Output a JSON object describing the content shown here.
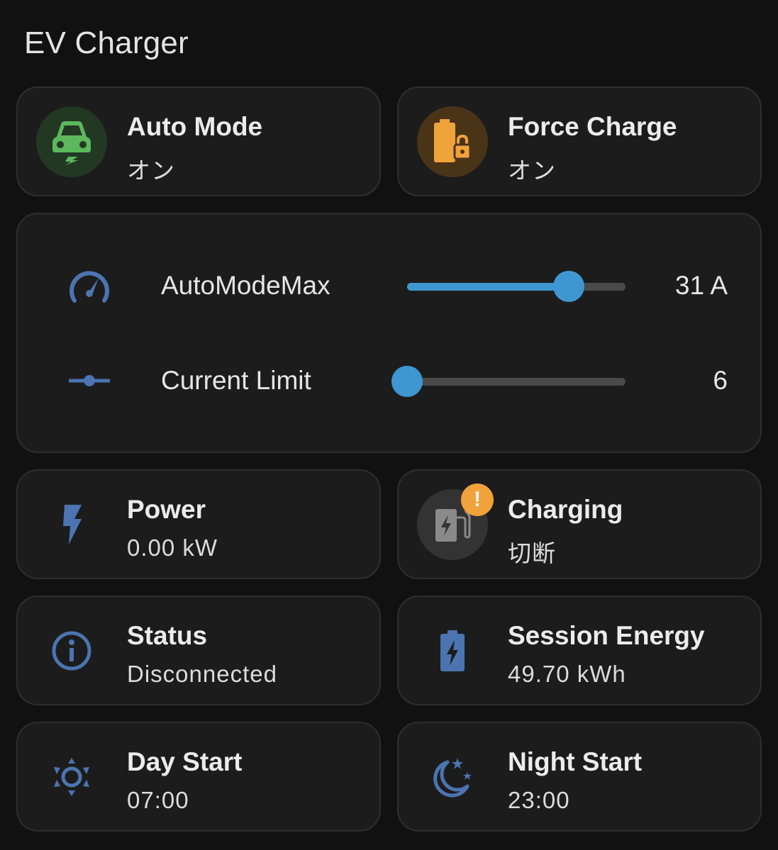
{
  "title": "EV Charger",
  "colors": {
    "accent": "#3e97d1",
    "icon_blue": "#4b74b0",
    "auto_mode_green": "#5cb85c",
    "force_charge_orange": "#f0a23b"
  },
  "tiles": {
    "auto_mode": {
      "name": "Auto Mode",
      "state": "オン",
      "icon": "car-electric-icon"
    },
    "force_charge": {
      "name": "Force Charge",
      "state": "オン",
      "icon": "battery-lock-icon"
    },
    "power": {
      "name": "Power",
      "state": "0.00 kW",
      "icon": "flash-icon"
    },
    "charging": {
      "name": "Charging",
      "state": "切断",
      "icon": "ev-station-icon",
      "badge": "!"
    },
    "status": {
      "name": "Status",
      "state": "Disconnected",
      "icon": "information-icon"
    },
    "session_energy": {
      "name": "Session Energy",
      "state": "49.70 kWh",
      "icon": "battery-charging-icon"
    },
    "day_start": {
      "name": "Day Start",
      "state": "07:00",
      "icon": "sun-icon"
    },
    "night_start": {
      "name": "Night Start",
      "state": "23:00",
      "icon": "moon-stars-icon"
    }
  },
  "sliders": {
    "auto_mode_max": {
      "label": "AutoModeMax",
      "value_text": "31 A",
      "fraction": 0.74,
      "icon": "speedometer-icon"
    },
    "current_limit": {
      "label": "Current Limit",
      "value_text": "6",
      "fraction": 0.0,
      "icon": "slider-line-icon"
    }
  }
}
